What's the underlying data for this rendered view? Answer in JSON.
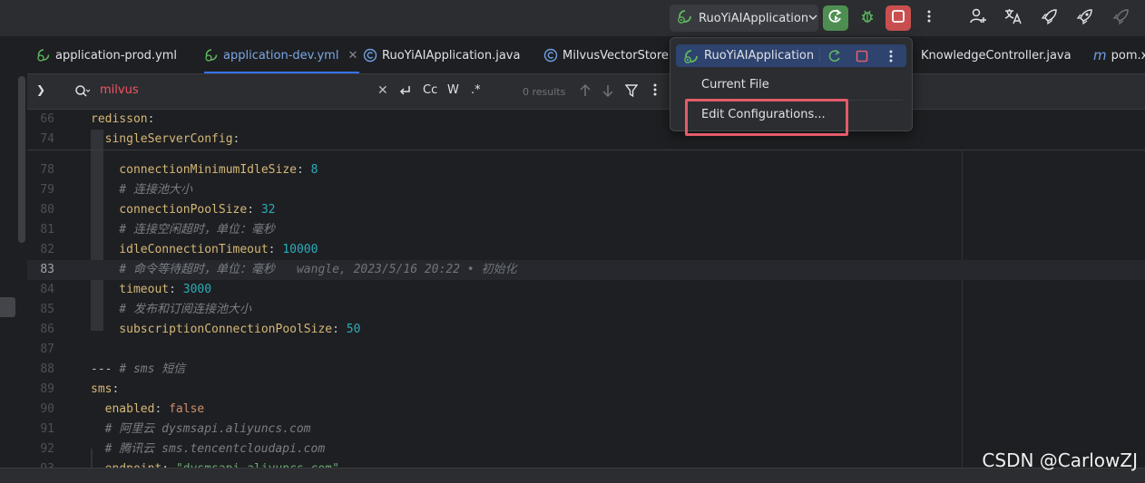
{
  "toolbar": {
    "run_config_label": "RuoYiAIApplication",
    "icons": [
      "run-config-icon",
      "chevron-down-icon",
      "rerun-icon",
      "bug-icon",
      "stop-icon",
      "more-vertical-icon",
      "add-user-icon",
      "translate-icon",
      "rocket-icon",
      "rocket-outline-icon",
      "rocket-disabled-icon"
    ]
  },
  "tabs": [
    {
      "label": "application-prod.yml",
      "icon": "yaml-run-icon",
      "active": false
    },
    {
      "label": "application-dev.yml",
      "icon": "yaml-run-icon",
      "active": true,
      "close": "✕"
    },
    {
      "label": "RuoYiAIApplication.java",
      "icon": "class-run-icon",
      "active": false
    },
    {
      "label": "MilvusVectorStore.ja",
      "icon": "class-icon",
      "active": false
    },
    {
      "label": "KnowledgeController.java",
      "icon": "class-icon",
      "active": false
    },
    {
      "label": "pom.x",
      "icon": "maven-icon",
      "active": false
    }
  ],
  "find": {
    "query": "milvus",
    "case_label": "Cc",
    "word_label": "W",
    "regex_label": ".*",
    "results": "0 results"
  },
  "editor": {
    "lines": [
      {
        "n": "66",
        "tokens": [
          {
            "t": "redisson",
            "c": "key"
          },
          {
            "t": ":",
            "c": "plain"
          }
        ]
      },
      {
        "n": "74",
        "tokens": [
          {
            "t": "  singleServerConfig",
            "c": "key"
          },
          {
            "t": ":",
            "c": "plain"
          }
        ]
      },
      {
        "n": "78",
        "tokens": [
          {
            "t": "    connectionMinimumIdleSize",
            "c": "key"
          },
          {
            "t": ": ",
            "c": "plain"
          },
          {
            "t": "8",
            "c": "num"
          }
        ]
      },
      {
        "n": "79",
        "tokens": [
          {
            "t": "    # 连接池大小",
            "c": "cmt"
          }
        ]
      },
      {
        "n": "80",
        "tokens": [
          {
            "t": "    connectionPoolSize",
            "c": "key"
          },
          {
            "t": ": ",
            "c": "plain"
          },
          {
            "t": "32",
            "c": "num"
          }
        ]
      },
      {
        "n": "81",
        "tokens": [
          {
            "t": "    # 连接空闲超时，单位：毫秒",
            "c": "cmt"
          }
        ]
      },
      {
        "n": "82",
        "tokens": [
          {
            "t": "    idleConnectionTimeout",
            "c": "key"
          },
          {
            "t": ": ",
            "c": "plain"
          },
          {
            "t": "10000",
            "c": "num"
          }
        ]
      },
      {
        "n": "83",
        "tokens": [
          {
            "t": "    # 命令等待超时，单位：毫秒",
            "c": "cmt"
          }
        ],
        "blame": "wangle, 2023/5/16 20:22 • 初始化",
        "current": true
      },
      {
        "n": "84",
        "tokens": [
          {
            "t": "    timeout",
            "c": "key"
          },
          {
            "t": ": ",
            "c": "plain"
          },
          {
            "t": "3000",
            "c": "num"
          }
        ]
      },
      {
        "n": "85",
        "tokens": [
          {
            "t": "    # 发布和订阅连接池大小",
            "c": "cmt"
          }
        ]
      },
      {
        "n": "86",
        "tokens": [
          {
            "t": "    subscriptionConnectionPoolSize",
            "c": "key"
          },
          {
            "t": ": ",
            "c": "plain"
          },
          {
            "t": "50",
            "c": "num"
          }
        ]
      },
      {
        "n": "87",
        "tokens": []
      },
      {
        "n": "88",
        "tokens": [
          {
            "t": "--- ",
            "c": "plain"
          },
          {
            "t": "# sms 短信",
            "c": "cmt"
          }
        ]
      },
      {
        "n": "89",
        "tokens": [
          {
            "t": "sms",
            "c": "key"
          },
          {
            "t": ":",
            "c": "plain"
          }
        ]
      },
      {
        "n": "90",
        "tokens": [
          {
            "t": "  enabled",
            "c": "key"
          },
          {
            "t": ": ",
            "c": "plain"
          },
          {
            "t": "false",
            "c": "kw"
          }
        ]
      },
      {
        "n": "91",
        "tokens": [
          {
            "t": "  # 阿里云 dysmsapi.aliyuncs.com",
            "c": "cmt"
          }
        ]
      },
      {
        "n": "92",
        "tokens": [
          {
            "t": "  # 腾讯云 sms.tencentcloudapi.com",
            "c": "cmt"
          }
        ]
      },
      {
        "n": "93",
        "tokens": [
          {
            "t": "  endpoint",
            "c": "key"
          },
          {
            "t": ": ",
            "c": "plain"
          },
          {
            "t": "\"dysmsapi.aliyuncs.com\"",
            "c": "str"
          }
        ]
      }
    ]
  },
  "popup": {
    "app_label": "RuoYiAIApplication",
    "current_file_label": "Current File",
    "edit_config_label": "Edit Configurations..."
  },
  "watermark": "CSDN @CarlowZJ",
  "colors": {
    "accent": "#3574f0",
    "run": "#4e8f51",
    "stop": "#c94f4f",
    "highlight": "#e25c6a",
    "search_text": "#f75464"
  }
}
